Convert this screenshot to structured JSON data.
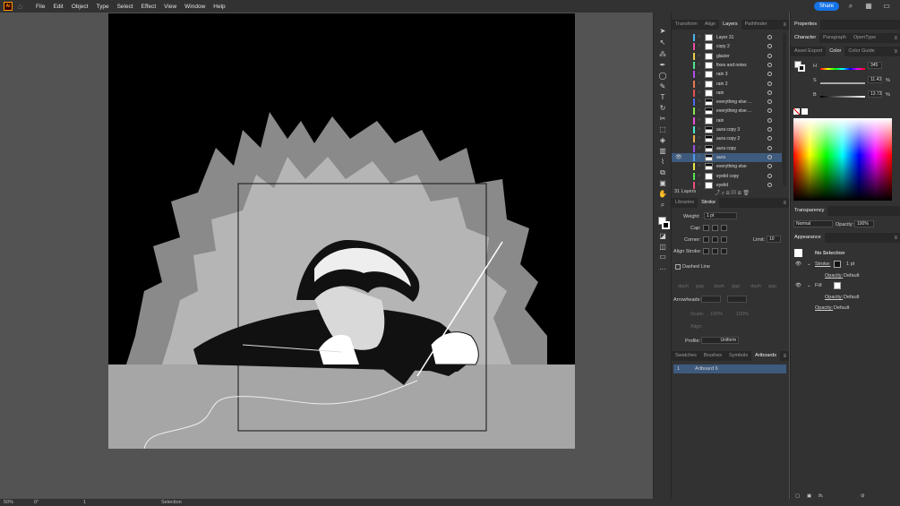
{
  "menubar": {
    "logo": "Ai",
    "items": [
      "File",
      "Edit",
      "Object",
      "Type",
      "Select",
      "Effect",
      "View",
      "Window",
      "Help"
    ],
    "share": "Share"
  },
  "status": {
    "zoom": "50%",
    "rotation": "0°",
    "artboard": "1",
    "tool": "Selection"
  },
  "layers_panel": {
    "tabs": [
      "Transform",
      "Align",
      "Layers",
      "Pathfinder"
    ],
    "active_tab": "Layers",
    "rows": [
      {
        "name": "Layer 31",
        "color": "#4fb3e8",
        "thumb": "white",
        "selected": false,
        "visible": false
      },
      {
        "name": "copy 2",
        "color": "#e84fa0",
        "thumb": "white",
        "selected": false,
        "visible": false
      },
      {
        "name": "glacier",
        "color": "#e8d04f",
        "thumb": "white",
        "selected": false,
        "visible": false
      },
      {
        "name": "fixes and notes",
        "color": "#4fe88f",
        "thumb": "white",
        "selected": false,
        "visible": false
      },
      {
        "name": "rain 3",
        "color": "#b04fe8",
        "thumb": "white",
        "selected": false,
        "visible": false
      },
      {
        "name": "rain 2",
        "color": "#e8794f",
        "thumb": "white",
        "selected": false,
        "visible": false
      },
      {
        "name": "rain",
        "color": "#e84f4f",
        "thumb": "white",
        "selected": false,
        "visible": false
      },
      {
        "name": "everything else ...",
        "color": "#4f6be8",
        "thumb": "dark",
        "selected": false,
        "visible": false
      },
      {
        "name": "everything else ...",
        "color": "#8be84f",
        "thumb": "dark",
        "selected": false,
        "visible": false
      },
      {
        "name": "rain",
        "color": "#e84fd8",
        "thumb": "white",
        "selected": false,
        "visible": false
      },
      {
        "name": "aura copy 3",
        "color": "#4fe8d4",
        "thumb": "dark",
        "selected": false,
        "visible": false
      },
      {
        "name": "aura copy 2",
        "color": "#e8b44f",
        "thumb": "dark",
        "selected": false,
        "visible": false
      },
      {
        "name": "aura copy",
        "color": "#9a4fe8",
        "thumb": "dark",
        "selected": false,
        "visible": false
      },
      {
        "name": "aura",
        "color": "#4f9ae8",
        "thumb": "dark",
        "selected": true,
        "visible": true
      },
      {
        "name": "everything else",
        "color": "#e8e84f",
        "thumb": "dark",
        "selected": false,
        "visible": false
      },
      {
        "name": "eyelid copy",
        "color": "#4fe84f",
        "thumb": "white",
        "selected": false,
        "visible": false
      },
      {
        "name": "eyelid",
        "color": "#e84f7b",
        "thumb": "white",
        "selected": false,
        "visible": false
      }
    ],
    "count": "31 Layers"
  },
  "stroke_panel": {
    "tabs": [
      "Libraries",
      "Stroke"
    ],
    "active_tab": "Stroke",
    "weight_label": "Weight:",
    "weight_value": "1 pt",
    "cap_label": "Cap:",
    "corner_label": "Corner:",
    "limit_label": "Limit:",
    "limit_value": "10",
    "align_label": "Align Stroke:",
    "dashed_label": "Dashed Line",
    "dash_labels": [
      "dash",
      "gap",
      "dash",
      "gap",
      "dash",
      "gap"
    ],
    "arrowheads_label": "Arrowheads:",
    "scale_label": "Scale:",
    "scale_values": [
      "100%",
      "100%"
    ],
    "align_arrow_label": "Align:",
    "profile_label": "Profile:",
    "profile_value": "Uniform"
  },
  "artboards_panel": {
    "tabs": [
      "Swatches",
      "Brushes",
      "Symbols",
      "Artboards"
    ],
    "active_tab": "Artboards",
    "row_number": "1",
    "row_name": "Artboard 6"
  },
  "properties": {
    "title": "Properties",
    "tabs_top": [
      "Character",
      "Paragraph",
      "OpenType"
    ],
    "tabs_color": [
      "Asset Export",
      "Color",
      "Color Guide"
    ],
    "active_color_tab": "Color",
    "h_label": "H",
    "h_value": "345",
    "s_label": "S",
    "s_value": "11.43",
    "b_label": "B",
    "b_value": "13.73",
    "pct": "%",
    "transparency_title": "Transparency",
    "blend_mode": "Normal",
    "opacity_label": "Opacity:",
    "opacity_value": "100%",
    "appearance_title": "Appearance",
    "no_selection": "No Selection",
    "stroke_label": "Stroke:",
    "stroke_value": "1 pt",
    "fill_label": "Fill:",
    "opacity_default": "Default",
    "fx_label": "fx."
  }
}
